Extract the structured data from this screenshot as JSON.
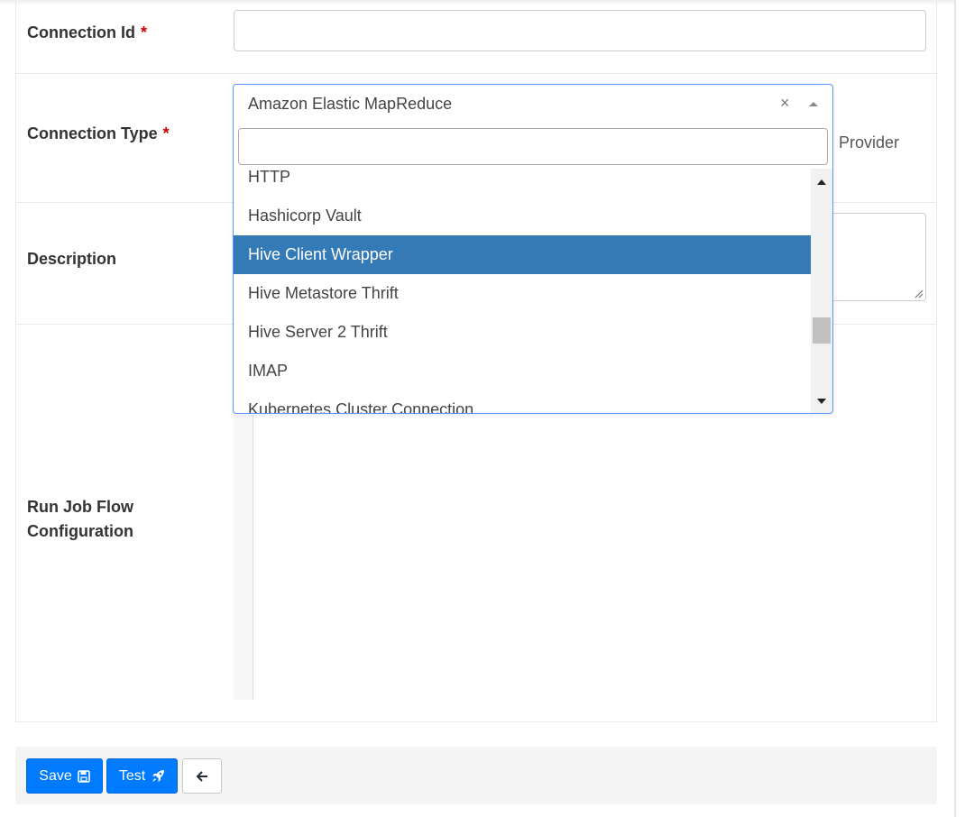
{
  "form": {
    "connection_id": {
      "label": "Connection Id",
      "required_mark": "*",
      "value": ""
    },
    "connection_type": {
      "label": "Connection Type",
      "required_mark": "*",
      "selected": "Amazon Elastic MapReduce",
      "clear_glyph": "×",
      "provider_text": "Provider"
    },
    "description": {
      "label": "Description",
      "value": ""
    },
    "run_job_flow": {
      "label_line1": "Run Job Flow",
      "label_line2": "Configuration"
    }
  },
  "dropdown": {
    "search_value": "",
    "options": [
      {
        "label": "HTTP",
        "active": false
      },
      {
        "label": "Hashicorp Vault",
        "active": false
      },
      {
        "label": "Hive Client Wrapper",
        "active": true
      },
      {
        "label": "Hive Metastore Thrift",
        "active": false
      },
      {
        "label": "Hive Server 2 Thrift",
        "active": false
      },
      {
        "label": "IMAP",
        "active": false
      },
      {
        "label": "Kubernetes Cluster Connection",
        "active": false
      }
    ],
    "highlight_color": "#337ab7"
  },
  "footer": {
    "save_label": "Save",
    "test_label": "Test",
    "save_icon": "floppy-disk-icon",
    "test_icon": "rocket-icon",
    "back_icon": "arrow-left-icon",
    "primary_color": "#007bff"
  }
}
